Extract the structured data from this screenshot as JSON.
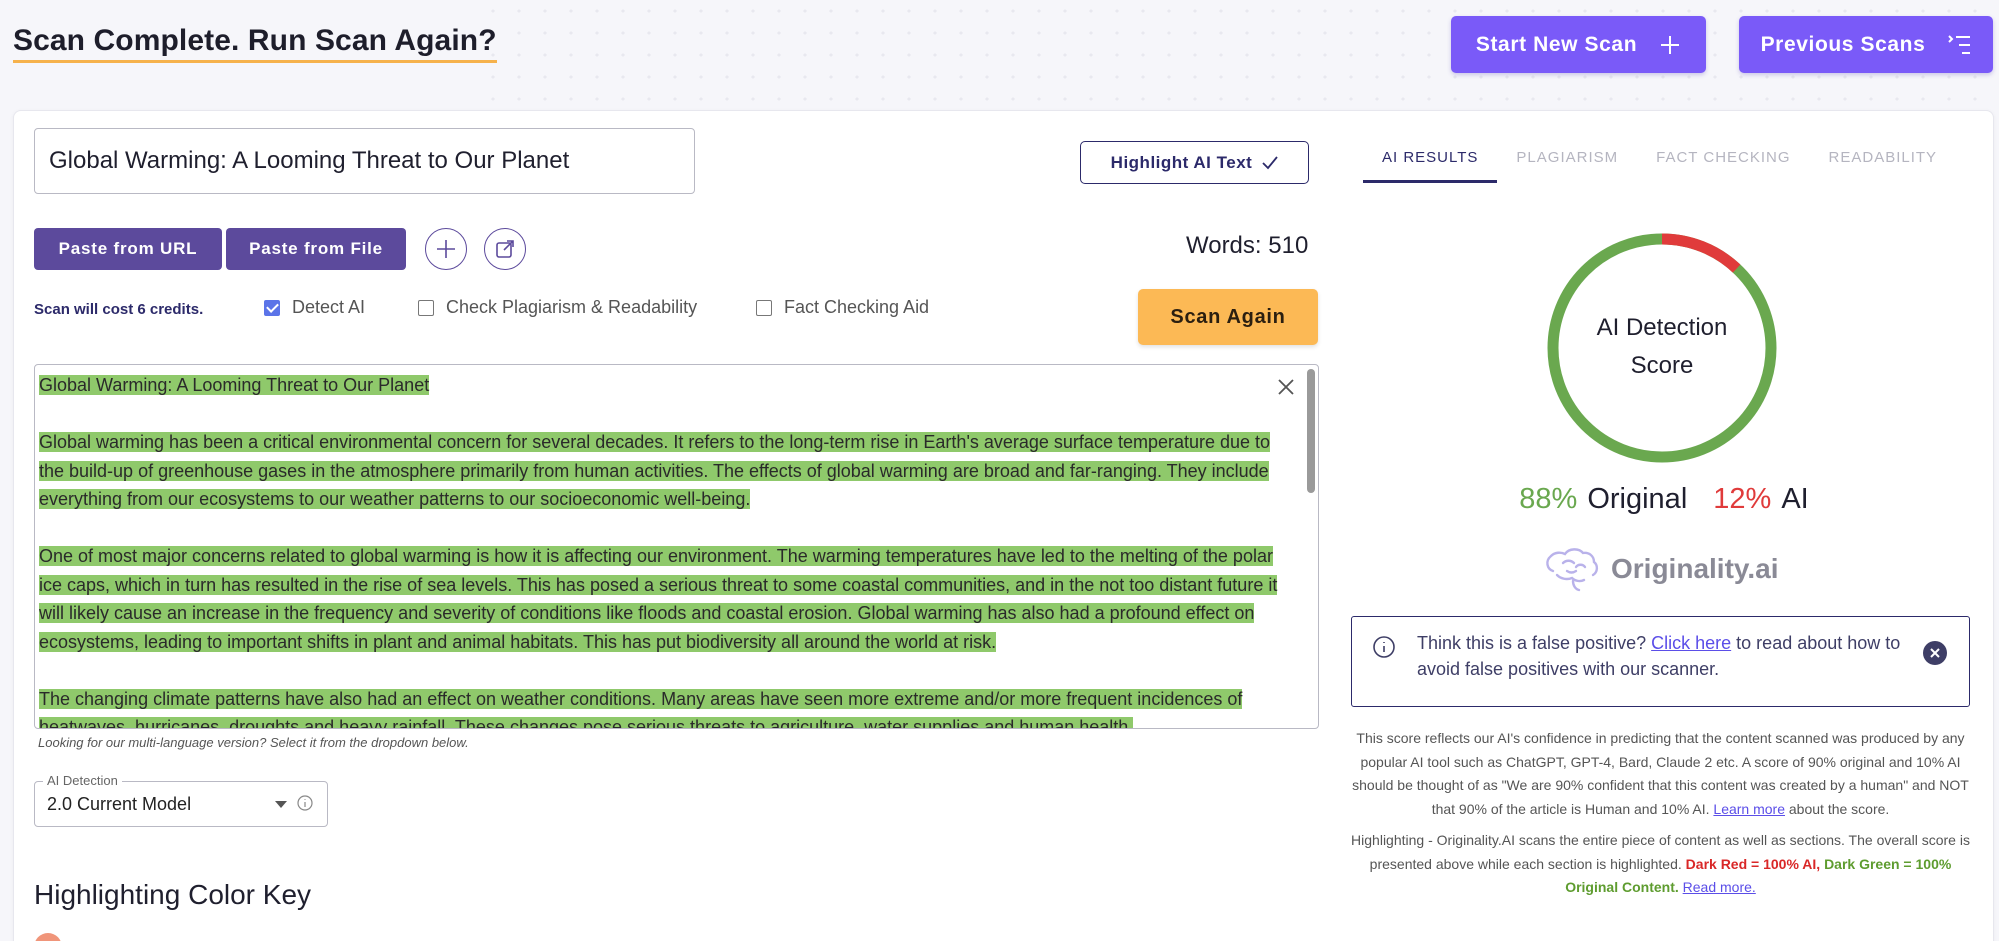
{
  "header": {
    "title": "Scan Complete. Run Scan Again?",
    "start_new_scan": "Start New Scan",
    "previous_scans": "Previous Scans"
  },
  "editor": {
    "title_value": "Global Warming: A Looming Threat to Our Planet",
    "highlight_btn": "Highlight AI Text",
    "paste_url": "Paste from URL",
    "paste_file": "Paste from File",
    "words": "Words: 510",
    "cost": "Scan will cost 6 credits.",
    "options": {
      "detect_ai": "Detect AI",
      "plagiarism": "Check Plagiarism & Readability",
      "fact_checking": "Fact Checking Aid"
    },
    "options_checked": {
      "detect_ai": true,
      "plagiarism": false,
      "fact_checking": false
    },
    "scan_again": "Scan Again",
    "paragraphs": [
      "Global Warming: A Looming Threat to Our Planet",
      "Global warming has been a critical environmental concern for several decades. It refers to the long-term rise in Earth's average surface temperature due to the build-up of greenhouse gases in the atmosphere primarily from human activities. The effects of global warming are broad and far-ranging. They include everything from our ecosystems to our weather patterns to our socioeconomic well-being.",
      "One of most major concerns related to global warming is how it is affecting our environment. The warming temperatures have led to the melting of the polar ice caps, which in turn has resulted in the rise of sea levels. This has posed a serious threat to some coastal communities, and in the not too distant future it will likely cause an increase in the frequency and severity of conditions like floods and coastal erosion. Global warming has also had a profound effect on ecosystems, leading to important shifts in plant and animal habitats. This has put biodiversity all around the world at risk.",
      "The changing climate patterns have also had an effect on weather conditions. Many areas have seen more extreme and/or more frequent incidences of heatwaves, hurricanes, droughts and heavy rainfall. These changes pose serious threats to agriculture, water supplies and human health."
    ],
    "multi_language_note": "Looking for our multi-language version? Select it from the dropdown below.",
    "model_legend": "AI Detection",
    "model_value": "2.0 Current Model",
    "color_key_title": "Highlighting Color Key"
  },
  "results": {
    "tabs": [
      "AI RESULTS",
      "PLAGIARISM",
      "FACT CHECKING",
      "READABILITY"
    ],
    "active_tab": 0,
    "donut_label_line1": "AI Detection",
    "donut_label_line2": "Score",
    "original_pct": 88,
    "ai_pct": 12,
    "original_pct_text": "88%",
    "original_label": "Original",
    "ai_pct_text": "12%",
    "ai_label": "AI",
    "colors": {
      "original": "#6aa84f",
      "ai": "#e03b3b",
      "accent": "#7a5af8"
    },
    "logo_text": "Originality.ai",
    "fp_text_before": "Think this is a false positive?",
    "fp_link": "Click here",
    "fp_text_after": "to read about how to avoid false positives with our scanner.",
    "explain_p1": "This score reflects our AI's confidence in predicting that the content scanned was produced by any popular AI tool such as ChatGPT, GPT-4, Bard, Claude 2 etc. A score of 90% original and 10% AI should be thought of as \"We are 90% confident that this content was created by a human\" and NOT that 90% of the article is Human and 10% AI. Learn more about the score.",
    "explain_p1_link": "Learn more",
    "explain_p1_tail": "about the score.",
    "explain_p2": "Highlighting - Originality.AI scans the entire piece of content as well as sections. The overall score is presented above while each section is highlighted.",
    "explain_red": "Dark Red = 100% AI,",
    "explain_green": "Dark Green = 100% Original Content.",
    "explain_read_more": "Read more."
  }
}
